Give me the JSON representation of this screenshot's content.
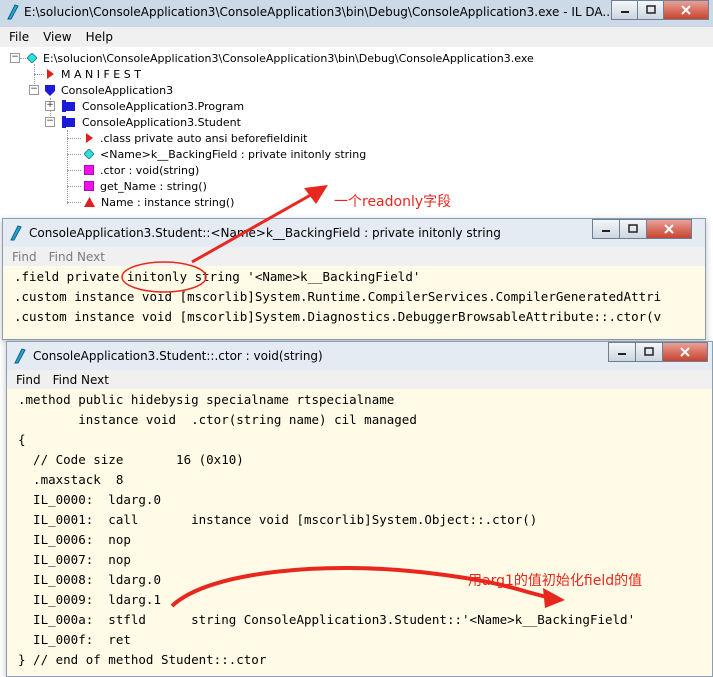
{
  "main_window": {
    "title": "E:\\solucion\\ConsoleApplication3\\ConsoleApplication3\\bin\\Debug\\ConsoleApplication3.exe - IL DA...",
    "menu": [
      "File",
      "View",
      "Help"
    ]
  },
  "tree": {
    "items": [
      {
        "label": "E:\\solucion\\ConsoleApplication3\\ConsoleApplication3\\bin\\Debug\\ConsoleApplication3.exe",
        "icon": "cyan-diamond"
      },
      {
        "label": "M A N I F E S T",
        "icon": "red-triangle"
      },
      {
        "label": "ConsoleApplication3",
        "icon": "blue-shield"
      },
      {
        "label": "ConsoleApplication3.Program",
        "icon": "blue-class"
      },
      {
        "label": "ConsoleApplication3.Student",
        "icon": "blue-class"
      },
      {
        "label": ".class private auto ansi beforefieldinit",
        "icon": "red-triangle"
      },
      {
        "label": "<Name>k__BackingField : private initonly string",
        "icon": "cyan-diamond"
      },
      {
        "label": ".ctor : void(string)",
        "icon": "magenta-square"
      },
      {
        "label": "get_Name : string()",
        "icon": "magenta-square"
      },
      {
        "label": "Name : instance string()",
        "icon": "red-up-triangle"
      }
    ]
  },
  "field_window": {
    "title": "ConsoleApplication3.Student::<Name>k__BackingField : private initonly string",
    "menu": [
      "Find",
      "Find Next"
    ],
    "lines": [
      ".field private initonly string '<Name>k__BackingField'",
      ".custom instance void [mscorlib]System.Runtime.CompilerServices.CompilerGeneratedAttri",
      ".custom instance void [mscorlib]System.Diagnostics.DebuggerBrowsableAttribute::.ctor(v"
    ]
  },
  "ctor_window": {
    "title": "ConsoleApplication3.Student::.ctor : void(string)",
    "menu": [
      "Find",
      "Find Next"
    ],
    "lines": [
      ".method public hidebysig specialname rtspecialname",
      "        instance void  .ctor(string name) cil managed",
      "{",
      "  // Code size       16 (0x10)",
      "  .maxstack  8",
      "  IL_0000:  ldarg.0",
      "  IL_0001:  call       instance void [mscorlib]System.Object::.ctor()",
      "  IL_0006:  nop",
      "  IL_0007:  nop",
      "  IL_0008:  ldarg.0",
      "  IL_0009:  ldarg.1",
      "  IL_000a:  stfld      string ConsoleApplication3.Student::'<Name>k__BackingField'",
      "  IL_000f:  ret",
      "} // end of method Student::.ctor"
    ]
  },
  "annotations": {
    "readonly_note": "一个readonly字段",
    "init_note": "用arg1的值初始化field的值",
    "color": "#e8281e"
  }
}
